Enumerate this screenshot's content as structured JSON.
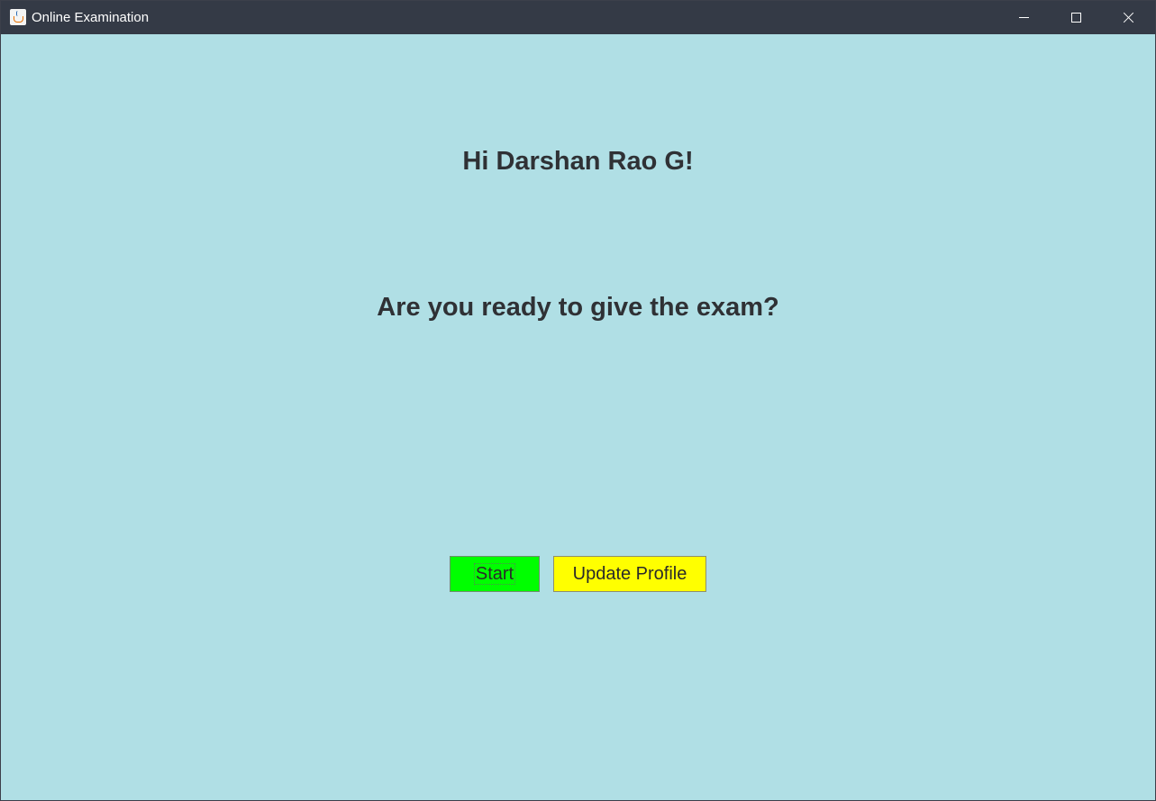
{
  "window": {
    "title": "Online Examination",
    "controls": {
      "minimize_icon": "minimize-icon",
      "maximize_icon": "maximize-icon",
      "close_icon": "close-icon"
    }
  },
  "main": {
    "greeting": "Hi Darshan Rao G!",
    "question": "Are you ready to give the exam?",
    "buttons": {
      "start_label": "Start",
      "update_profile_label": "Update Profile"
    }
  },
  "colors": {
    "background": "#b0dfe5",
    "titlebar": "#343a46",
    "start_button": "#00ff00",
    "update_button": "#ffff00",
    "text": "#2f3135"
  }
}
